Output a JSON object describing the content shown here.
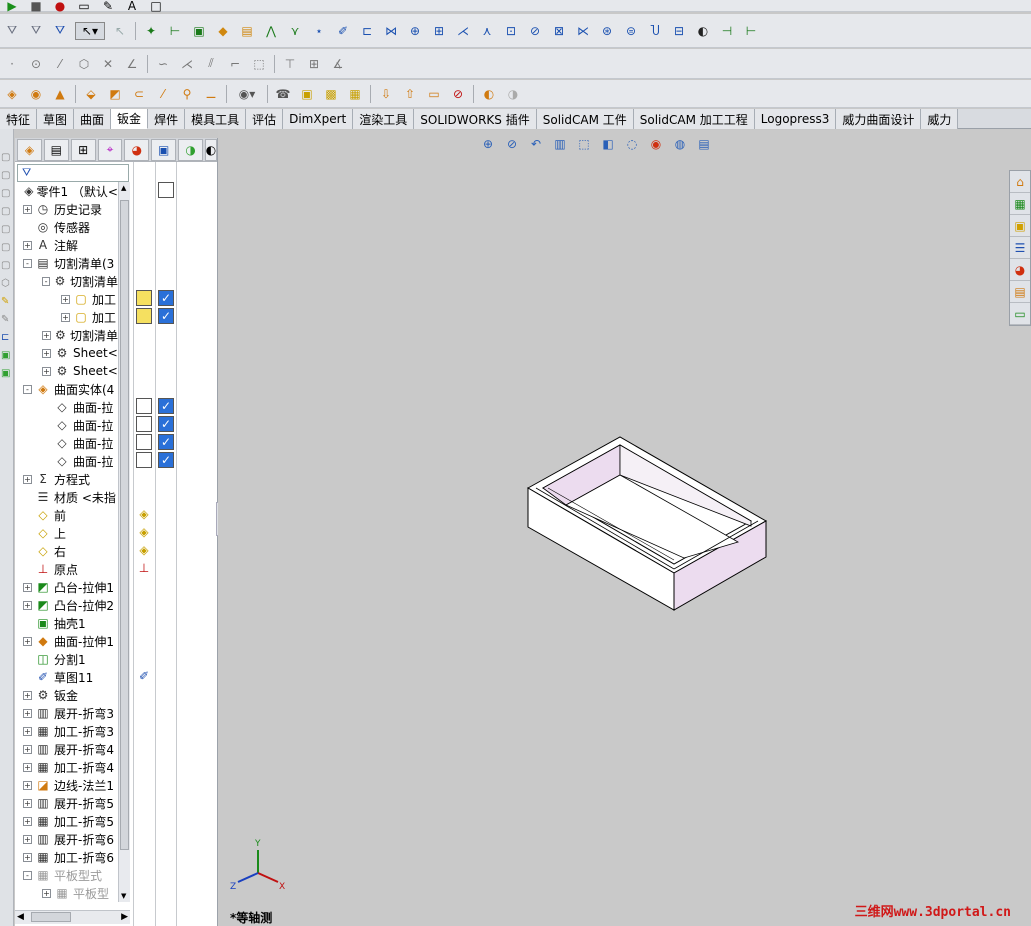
{
  "toolbars": {
    "row1_icons": [
      "play-icon",
      "stop-icon",
      "record-icon",
      "document-icon",
      "edit-document-icon",
      "text-a-icon",
      "box-icon"
    ],
    "row2_icons": [
      "smart-dimension-icon",
      "select-filter-icon",
      "selection-icon",
      "select-arrow-icon",
      "pointer-icon",
      "sketch-icon"
    ],
    "row3_icons": [
      "point-icon",
      "circle-icon",
      "line-icon",
      "polygon-icon",
      "trim-icon",
      "line2-icon",
      "fillet-icon",
      "chamfer-icon"
    ],
    "row4_icons": [
      "extrude-icon",
      "revolve-icon",
      "sweep-icon",
      "loft-icon",
      "fillet-feature-icon",
      "shell-icon"
    ]
  },
  "tabs": [
    {
      "label": "特征",
      "active": false
    },
    {
      "label": "草图",
      "active": false
    },
    {
      "label": "曲面",
      "active": false
    },
    {
      "label": "钣金",
      "active": true
    },
    {
      "label": "焊件",
      "active": false
    },
    {
      "label": "模具工具",
      "active": false
    },
    {
      "label": "评估",
      "active": false
    },
    {
      "label": "DimXpert",
      "active": false
    },
    {
      "label": "渲染工具",
      "active": false
    },
    {
      "label": "SOLIDWORKS 插件",
      "active": false
    },
    {
      "label": "SolidCAM 工件",
      "active": false
    },
    {
      "label": "SolidCAM 加工工程",
      "active": false
    },
    {
      "label": "Logopress3",
      "active": false
    },
    {
      "label": "威力曲面设计",
      "active": false
    },
    {
      "label": "威力",
      "active": false
    }
  ],
  "feature_manager": {
    "filter_icon": "funnel-icon",
    "tree": [
      {
        "label": "零件1 （默认<",
        "level": 0,
        "icon": "part-icon",
        "expander": ""
      },
      {
        "label": "历史记录",
        "level": 1,
        "icon": "history-icon",
        "expander": "+"
      },
      {
        "label": "传感器",
        "level": 1,
        "icon": "sensor-icon",
        "expander": ""
      },
      {
        "label": "注解",
        "level": 1,
        "icon": "annotation-icon",
        "expander": "+"
      },
      {
        "label": "切割清单(3",
        "level": 1,
        "icon": "cutlist-icon",
        "expander": "-"
      },
      {
        "label": "切割清单",
        "level": 2,
        "icon": "cutlist-folder-icon",
        "expander": "-"
      },
      {
        "label": "加工",
        "level": 3,
        "icon": "solid-body-icon",
        "expander": "+"
      },
      {
        "label": "加工",
        "level": 3,
        "icon": "solid-body-icon",
        "expander": "+"
      },
      {
        "label": "切割清单",
        "level": 2,
        "icon": "cutlist-folder-icon",
        "expander": "+"
      },
      {
        "label": "Sheet<",
        "level": 2,
        "icon": "cutlist-folder-icon",
        "expander": "+"
      },
      {
        "label": "Sheet<",
        "level": 2,
        "icon": "cutlist-folder-icon",
        "expander": "+"
      },
      {
        "label": "曲面实体(4",
        "level": 1,
        "icon": "surface-bodies-icon",
        "expander": "-"
      },
      {
        "label": "曲面-拉",
        "level": 2,
        "icon": "surface-icon",
        "expander": ""
      },
      {
        "label": "曲面-拉",
        "level": 2,
        "icon": "surface-icon",
        "expander": ""
      },
      {
        "label": "曲面-拉",
        "level": 2,
        "icon": "surface-icon",
        "expander": ""
      },
      {
        "label": "曲面-拉",
        "level": 2,
        "icon": "surface-icon",
        "expander": ""
      },
      {
        "label": "方程式",
        "level": 1,
        "icon": "equation-icon",
        "expander": "+"
      },
      {
        "label": "材质 <未指",
        "level": 1,
        "icon": "material-icon",
        "expander": ""
      },
      {
        "label": "前",
        "level": 1,
        "icon": "plane-icon",
        "expander": ""
      },
      {
        "label": "上",
        "level": 1,
        "icon": "plane-icon",
        "expander": ""
      },
      {
        "label": "右",
        "level": 1,
        "icon": "plane-icon",
        "expander": ""
      },
      {
        "label": "原点",
        "level": 1,
        "icon": "origin-icon",
        "expander": ""
      },
      {
        "label": "凸台-拉伸1",
        "level": 1,
        "icon": "boss-extrude-icon",
        "expander": "+"
      },
      {
        "label": "凸台-拉伸2",
        "level": 1,
        "icon": "boss-extrude-icon",
        "expander": "+"
      },
      {
        "label": "抽壳1",
        "level": 1,
        "icon": "shell-icon",
        "expander": ""
      },
      {
        "label": "曲面-拉伸1",
        "level": 1,
        "icon": "surface-extrude-icon",
        "expander": "+"
      },
      {
        "label": "分割1",
        "level": 1,
        "icon": "split-icon",
        "expander": ""
      },
      {
        "label": "草图11",
        "level": 1,
        "icon": "sketch-icon",
        "expander": ""
      },
      {
        "label": "钣金",
        "level": 1,
        "icon": "sheetmetal-icon",
        "expander": "+"
      },
      {
        "label": "展开-折弯3",
        "level": 1,
        "icon": "unfold-icon",
        "expander": "+"
      },
      {
        "label": "加工-折弯3",
        "level": 1,
        "icon": "fold-icon",
        "expander": "+"
      },
      {
        "label": "展开-折弯4",
        "level": 1,
        "icon": "unfold-icon",
        "expander": "+"
      },
      {
        "label": "加工-折弯4",
        "level": 1,
        "icon": "fold-icon",
        "expander": "+"
      },
      {
        "label": "边线-法兰1",
        "level": 1,
        "icon": "edge-flange-icon",
        "expander": "+"
      },
      {
        "label": "展开-折弯5",
        "level": 1,
        "icon": "unfold-icon",
        "expander": "+"
      },
      {
        "label": "加工-折弯5",
        "level": 1,
        "icon": "fold-icon",
        "expander": "+"
      },
      {
        "label": "展开-折弯6",
        "level": 1,
        "icon": "unfold-icon",
        "expander": "+"
      },
      {
        "label": "加工-折弯6",
        "level": 1,
        "icon": "fold-icon",
        "expander": "+"
      },
      {
        "label": "平板型式",
        "level": 1,
        "icon": "flat-pattern-icon",
        "expander": "-",
        "disabled": true
      },
      {
        "label": "平板型",
        "level": 2,
        "icon": "flat-pattern-icon",
        "expander": "+",
        "disabled": true
      }
    ]
  },
  "viewport": {
    "view_label": "*等轴测",
    "watermark": "三维网www.3dportal.cn",
    "heads_up_icons": [
      "zoom-fit-icon",
      "zoom-area-icon",
      "previous-view-icon",
      "section-view-icon",
      "view-orientation-icon",
      "display-style-icon",
      "hide-show-icon",
      "appearance-icon",
      "scene-icon",
      "view-settings-icon"
    ],
    "task_pane_icons": [
      "home-icon",
      "resources-icon",
      "design-library-icon",
      "file-explorer-icon",
      "appearances-icon",
      "custom-properties-icon",
      "forum-icon"
    ]
  }
}
